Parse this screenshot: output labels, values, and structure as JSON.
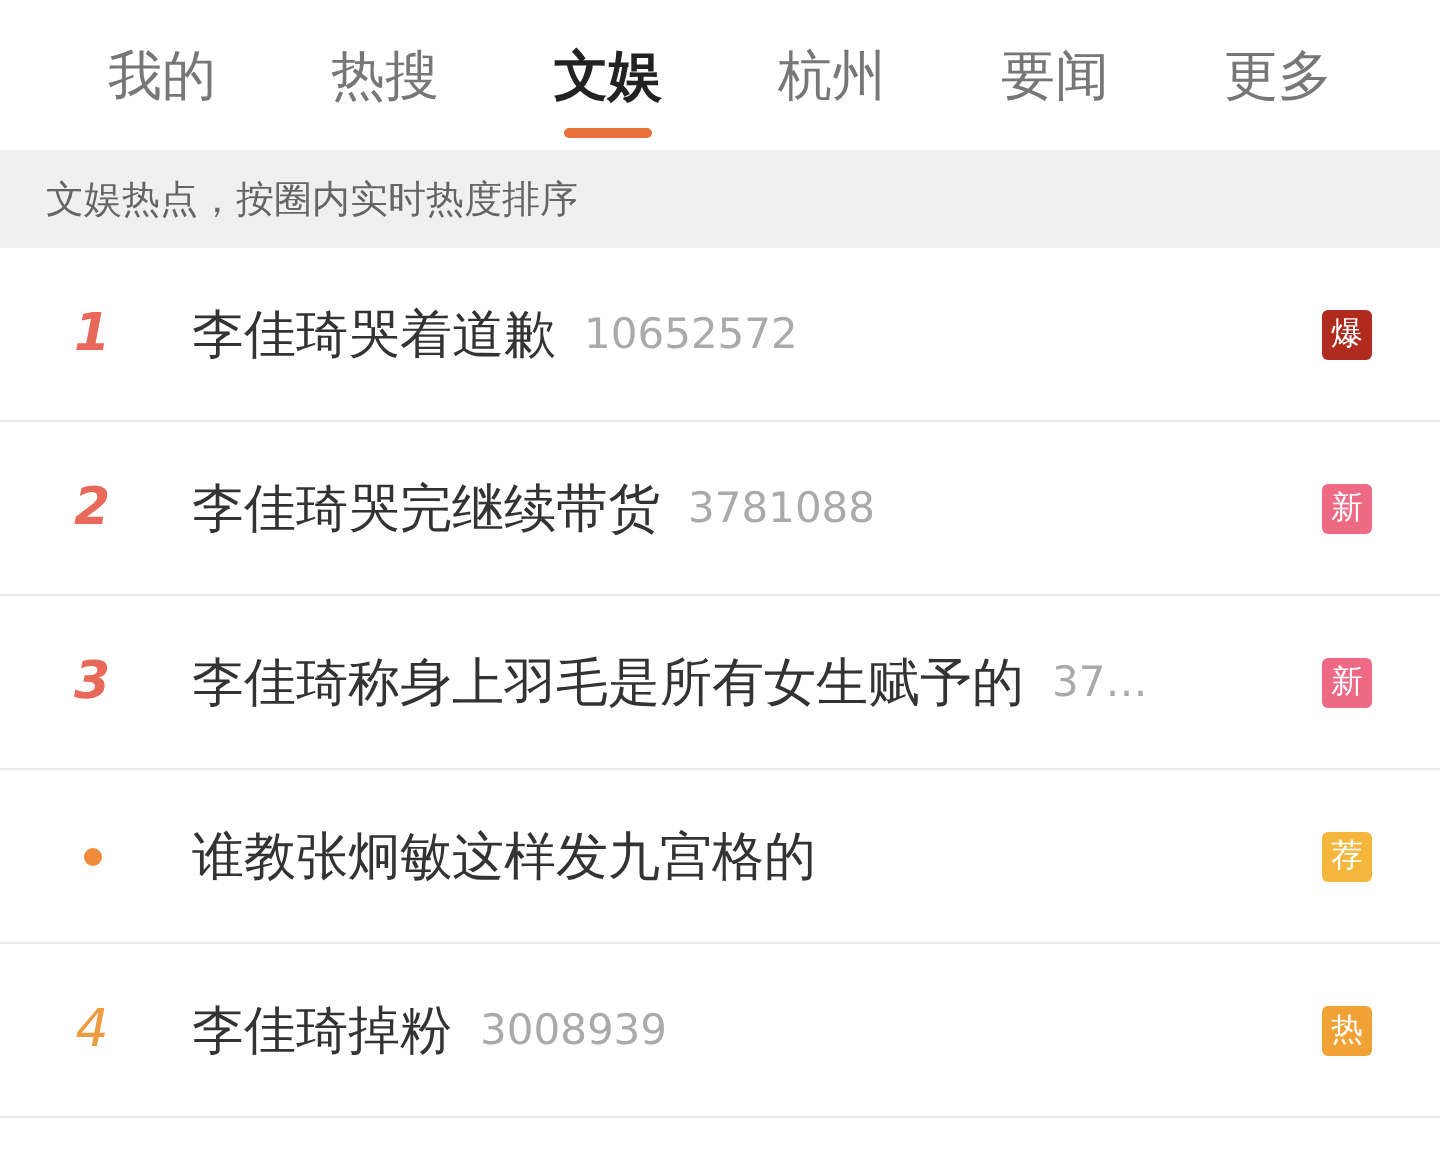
{
  "tabs": [
    {
      "label": "我的",
      "selected": false
    },
    {
      "label": "热搜",
      "selected": false
    },
    {
      "label": "文娱",
      "selected": true
    },
    {
      "label": "杭州",
      "selected": false
    },
    {
      "label": "要闻",
      "selected": false
    },
    {
      "label": "更多",
      "selected": false
    }
  ],
  "subtitle": "文娱热点，按圈内实时热度排序",
  "items": [
    {
      "kind": "rank",
      "rank": "1",
      "color": "#e8685a",
      "title": "李佳琦哭着道歉",
      "count": "10652572",
      "badge": {
        "text": "爆",
        "color": "#b02a1e"
      }
    },
    {
      "kind": "rank",
      "rank": "2",
      "color": "#e8685a",
      "title": "李佳琦哭完继续带货",
      "count": "3781088",
      "badge": {
        "text": "新",
        "color": "#ee6a84"
      }
    },
    {
      "kind": "rank",
      "rank": "3",
      "color": "#e8685a",
      "title": "李佳琦称身上羽毛是所有女生赋予的",
      "count": "37…",
      "badge": {
        "text": "新",
        "color": "#ee6a84"
      }
    },
    {
      "kind": "dot",
      "color": "#ee8a3a",
      "title": "谁教张炯敏这样发九宫格的",
      "badge": {
        "text": "荐",
        "color": "#f5b63c"
      }
    },
    {
      "kind": "rank",
      "rank": "4",
      "color": "#ef9a3e",
      "title": "李佳琦掉粉",
      "count": "3008939",
      "badge": {
        "text": "热",
        "color": "#f0a236"
      }
    }
  ]
}
